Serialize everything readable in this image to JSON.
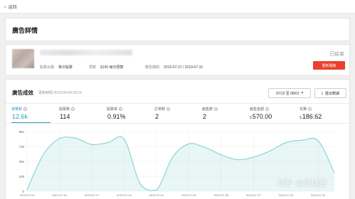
{
  "topbar": {
    "back_label": "返回"
  },
  "header": {
    "title": "廣告詳情"
  },
  "ad_detail": {
    "status": "已結束",
    "meta": [
      {
        "label": "點擊出價",
        "value": "單次點擊"
      },
      {
        "label": "預算",
        "value": "$190 每日預算"
      },
      {
        "label": "廣告期間",
        "value": "2019-07-21 / 2019-07-31"
      }
    ],
    "action_button": "重新開啟"
  },
  "performance": {
    "title": "廣告成效",
    "updated": "更新時間 2019-09-04 09:19",
    "date_range": "07/13 至 08/01",
    "export_label": "匯出數據",
    "metrics": [
      {
        "label": "瀏覽數",
        "value": "12.6k",
        "currency": "",
        "active": true
      },
      {
        "label": "點擊數",
        "value": "114",
        "currency": ""
      },
      {
        "label": "點擊率",
        "value": "0.91%",
        "currency": ""
      },
      {
        "label": "訂單數",
        "value": "2",
        "currency": ""
      },
      {
        "label": "銷售數",
        "value": "2",
        "currency": ""
      },
      {
        "label": "銷售金額",
        "value": "570.00",
        "currency": "$"
      },
      {
        "label": "花費",
        "value": "186.62",
        "currency": "$"
      }
    ]
  },
  "chart_data": {
    "type": "area",
    "color": "#7fd3cf",
    "ylabel": "",
    "ylim": [
      0,
      984
    ],
    "yticks": [
      0,
      246,
      492,
      738,
      984
    ],
    "xticks": [
      "2019-07-13",
      "2019-07-15",
      "2019-07-17",
      "2019-07-19",
      "2019-07-21",
      "2019-07-23",
      "2019-07-25",
      "2019-07-27",
      "2019-07-29",
      "2019-07-31"
    ],
    "x": [
      "2019-07-13",
      "2019-07-14",
      "2019-07-15",
      "2019-07-16",
      "2019-07-17",
      "2019-07-18",
      "2019-07-19",
      "2019-07-20",
      "2019-07-21",
      "2019-07-22",
      "2019-07-23",
      "2019-07-24",
      "2019-07-25",
      "2019-07-26",
      "2019-07-27",
      "2019-07-28",
      "2019-07-29",
      "2019-07-30",
      "2019-07-31",
      "2019-08-01"
    ],
    "values": [
      20,
      600,
      865,
      875,
      770,
      800,
      860,
      120,
      20,
      560,
      780,
      720,
      600,
      520,
      560,
      660,
      800,
      840,
      830,
      300
    ]
  },
  "watermark": "知乎 @任塘蕙"
}
